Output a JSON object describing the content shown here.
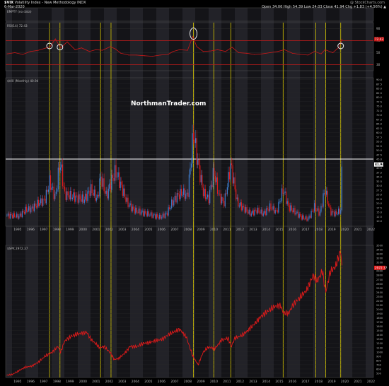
{
  "header": {
    "symbol": "$VIX",
    "name": "Volatility Index - New Methodology",
    "exchange": "INDX",
    "date": "6-Mar-2020",
    "brand": "@ StockCharts.com",
    "ohlc": "Open 34.06  High 54.39  Low 24.03  Close 41.94  Chg +1.83 (+4.56%) ▲"
  },
  "watermark": "NorthmanTrader.com",
  "colors": {
    "background": "#000000",
    "band_dark": "#141418",
    "band_light": "#222228",
    "up_candle": "#3f7fd0",
    "down_candle": "#e01a1a",
    "rsi_line": "#c81818",
    "spx_line": "#e01a1a",
    "vertical_marker": "#d8c800",
    "circle": "#ffffff",
    "reference_line": "#ffffff"
  },
  "chart_data": [
    {
      "panel": "empty",
      "type": "line",
      "label": "EMPTY (no data)"
    },
    {
      "panel": "rsi",
      "type": "line",
      "label": "RSI(14) 72.43",
      "last_value": "72.43",
      "ylim": [
        20,
        100
      ],
      "y_ticks": [
        30,
        50,
        70,
        90
      ],
      "reference_lines": [
        70,
        30
      ],
      "x": [
        1994.6,
        1995.2,
        1995.8,
        1996.4,
        1997.0,
        1997.6,
        1997.9,
        1998.3,
        1998.7,
        1999.2,
        1999.8,
        2000.3,
        2000.9,
        2001.4,
        2001.9,
        2002.5,
        2002.9,
        2003.3,
        2003.9,
        2004.5,
        2005.1,
        2005.7,
        2006.3,
        2006.9,
        2007.3,
        2007.8,
        2008.4,
        2008.8,
        2009.1,
        2009.6,
        2010.2,
        2010.7,
        2011.3,
        2011.8,
        2012.3,
        2012.9,
        2013.5,
        2014.1,
        2014.7,
        2015.3,
        2015.8,
        2016.4,
        2017.0,
        2017.6,
        2018.1,
        2018.6,
        2018.9,
        2019.5,
        2020.0,
        2020.2
      ],
      "values": [
        48,
        50,
        47,
        52,
        54,
        58,
        60,
        73,
        58,
        68,
        55,
        58,
        52,
        55,
        54,
        60,
        56,
        49,
        46,
        46,
        45,
        44,
        46,
        47,
        52,
        55,
        54,
        77,
        60,
        52,
        53,
        55,
        52,
        59,
        50,
        49,
        47,
        48,
        50,
        52,
        55,
        49,
        47,
        46,
        52,
        48,
        55,
        50,
        60,
        72.43
      ],
      "circles_at": [
        1997.85,
        1998.65,
        2008.85,
        2020.1
      ]
    },
    {
      "panel": "vix",
      "type": "candlestick",
      "label": "$VIX (Monthly) 40.94",
      "last_value": "41.94",
      "ylim": [
        10,
        60
      ],
      "y_ticks": [
        10.0,
        12.5,
        15.0,
        17.5,
        20.0,
        22.5,
        25.0,
        27.5,
        30.0,
        32.5,
        35.0,
        37.5,
        40.0,
        42.5,
        45.0,
        47.5,
        50.0,
        52.5,
        55.0,
        57.5,
        60.0,
        62.5,
        65.0,
        67.5,
        70.0,
        72.5,
        75.0,
        77.5,
        80.0,
        82.5,
        85.0,
        87.5,
        90.0
      ],
      "reference_line": 45.0,
      "x": [
        1994.6,
        1995.0,
        1995.5,
        1996.0,
        1996.5,
        1997.0,
        1997.5,
        1997.85,
        1998.3,
        1998.65,
        1999.0,
        1999.5,
        2000.0,
        2000.5,
        2001.0,
        2001.5,
        2001.75,
        2002.2,
        2002.6,
        2002.9,
        2003.3,
        2003.8,
        2004.3,
        2004.8,
        2005.3,
        2005.8,
        2006.3,
        2006.8,
        2007.2,
        2007.6,
        2008.0,
        2008.4,
        2008.85,
        2009.2,
        2009.6,
        2010.0,
        2010.4,
        2010.8,
        2011.2,
        2011.7,
        2012.2,
        2012.7,
        2013.2,
        2013.7,
        2014.2,
        2014.7,
        2015.2,
        2015.7,
        2016.1,
        2016.6,
        2017.1,
        2017.6,
        2018.1,
        2018.5,
        2018.9,
        2019.3,
        2019.7,
        2020.1,
        2020.2
      ],
      "values": [
        13,
        13,
        12.5,
        16,
        17,
        20,
        22,
        32,
        23,
        44,
        25,
        24,
        23,
        22,
        28,
        22,
        35,
        24,
        33,
        38,
        30,
        20,
        16,
        15,
        14,
        13,
        12,
        14,
        20,
        24,
        26,
        24,
        60,
        42,
        26,
        22,
        38,
        24,
        20,
        42,
        20,
        17,
        14,
        16,
        14,
        18,
        15,
        28,
        18,
        15,
        12,
        11,
        18,
        14,
        28,
        15,
        14,
        16,
        41.94
      ]
    },
    {
      "panel": "spx",
      "type": "line",
      "label": "$SPX 2972.37",
      "last_value": "2972.37",
      "ylim": [
        400,
        3500
      ],
      "y_ticks": [
        500,
        600,
        700,
        800,
        900,
        1000,
        1100,
        1200,
        1300,
        1400,
        1500,
        1600,
        1700,
        1800,
        1900,
        2000,
        2100,
        2200,
        2300,
        2400,
        2500,
        2600,
        2700,
        2800,
        2900,
        3000,
        3100,
        3200,
        3300,
        3400,
        3500
      ],
      "x": [
        1994.6,
        1995.0,
        1995.5,
        1996.0,
        1996.5,
        1997.0,
        1997.5,
        1998.0,
        1998.5,
        1998.7,
        1999.0,
        1999.5,
        2000.0,
        2000.7,
        2001.0,
        2001.7,
        2002.0,
        2002.5,
        2002.8,
        2003.2,
        2003.7,
        2004.0,
        2004.5,
        2005.0,
        2005.5,
        2006.0,
        2006.5,
        2007.0,
        2007.8,
        2008.3,
        2008.8,
        2009.2,
        2009.6,
        2010.0,
        2010.5,
        2011.0,
        2011.5,
        2011.75,
        2012.0,
        2012.5,
        2013.0,
        2013.5,
        2014.0,
        2014.5,
        2015.0,
        2015.5,
        2015.7,
        2016.1,
        2016.5,
        2017.0,
        2017.5,
        2018.0,
        2018.3,
        2018.7,
        2018.95,
        2019.3,
        2019.7,
        2020.1,
        2020.2
      ],
      "values": [
        455,
        470,
        560,
        640,
        670,
        760,
        900,
        980,
        1130,
        990,
        1250,
        1370,
        1420,
        1460,
        1300,
        1100,
        1130,
        980,
        820,
        860,
        1000,
        1130,
        1120,
        1200,
        1220,
        1270,
        1300,
        1420,
        1530,
        1350,
        900,
        700,
        1000,
        1110,
        1080,
        1280,
        1320,
        1130,
        1320,
        1380,
        1500,
        1650,
        1830,
        1950,
        2060,
        2090,
        1920,
        1900,
        2120,
        2280,
        2450,
        2800,
        2650,
        2900,
        2400,
        2880,
        3000,
        3380,
        2972.37
      ]
    }
  ],
  "x_axis": {
    "years": [
      "1995",
      "1996",
      "1997",
      "1998",
      "1999",
      "2000",
      "2001",
      "2002",
      "2003",
      "2004",
      "2005",
      "2006",
      "2007",
      "2008",
      "2009",
      "2010",
      "2011",
      "2012",
      "2013",
      "2014",
      "2015",
      "2016",
      "2017",
      "2018",
      "2019",
      "2020",
      "2021",
      "2022"
    ],
    "vertical_markers": [
      1997.85,
      1998.65,
      2001.75,
      2002.55,
      2008.85,
      2010.4,
      2011.7,
      2015.7,
      2018.2,
      2018.95,
      2020.1
    ]
  }
}
